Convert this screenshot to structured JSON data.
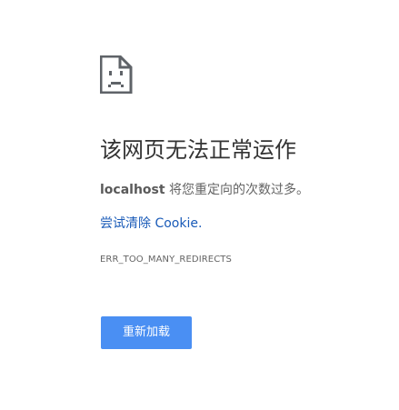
{
  "error": {
    "icon": "sad-document-icon",
    "title": "该网页无法正常运作",
    "host": "localhost",
    "message_suffix": " 将您重定向的次数过多。",
    "clear_cookies_link": "尝试清除 Cookie.",
    "code": "ERR_TOO_MANY_REDIRECTS",
    "reload_label": "重新加载"
  },
  "colors": {
    "background": "#ffffff",
    "title": "#333333",
    "text": "#646464",
    "link": "#1a5bb8",
    "button": "#4a8ff3",
    "button_text": "#ffffff",
    "icon": "#5f6368"
  }
}
